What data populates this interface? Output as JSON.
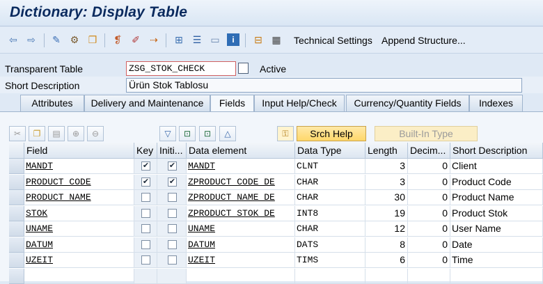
{
  "window": {
    "title": "Dictionary: Display Table"
  },
  "toolbar": {
    "icons": [
      "back-arrow-icon",
      "forward-arrow-icon",
      "other-object-icon",
      "display-change-icon",
      "activate-icon",
      "where-used-icon",
      "object-list-icon",
      "navigate-icon",
      "hierarchy-icon",
      "index-icon",
      "layout-icon",
      "info-icon",
      "tree-icon",
      "grid-icon"
    ],
    "technical_settings": "Technical Settings",
    "append_structure": "Append Structure..."
  },
  "header": {
    "table_type_label": "Transparent Table",
    "table_name": "ZSG_STOK_CHECK",
    "status": "Active",
    "short_desc_label": "Short Description",
    "short_desc_value": "Ürün Stok Tablosu"
  },
  "tabs": [
    {
      "label": "Attributes",
      "active": false
    },
    {
      "label": "Delivery and Maintenance",
      "active": false
    },
    {
      "label": "Fields",
      "active": true
    },
    {
      "label": "Input Help/Check",
      "active": false
    },
    {
      "label": "Currency/Quantity Fields",
      "active": false
    },
    {
      "label": "Indexes",
      "active": false
    }
  ],
  "grid_toolbar": {
    "search_help": "Srch Help",
    "built_in_type": "Built-In Type"
  },
  "table": {
    "columns": [
      "Field",
      "Key",
      "Initi...",
      "Data element",
      "Data Type",
      "Length",
      "Decim...",
      "Short Description"
    ],
    "rows": [
      {
        "field": "MANDT",
        "key": true,
        "init": true,
        "data_element": "MANDT",
        "data_type": "CLNT",
        "length": "3",
        "decimals": "0",
        "desc": "Client"
      },
      {
        "field": "PRODUCT_CODE",
        "key": true,
        "init": true,
        "data_element": "ZPRODUCT_CODE_DE",
        "data_type": "CHAR",
        "length": "3",
        "decimals": "0",
        "desc": "Product Code"
      },
      {
        "field": "PRODUCT_NAME",
        "key": false,
        "init": false,
        "data_element": "ZPRODUCT_NAME_DE",
        "data_type": "CHAR",
        "length": "30",
        "decimals": "0",
        "desc": "Product Name"
      },
      {
        "field": "STOK",
        "key": false,
        "init": false,
        "data_element": "ZPRODUCT_STOK_DE",
        "data_type": "INT8",
        "length": "19",
        "decimals": "0",
        "desc": "Product Stok"
      },
      {
        "field": "UNAME",
        "key": false,
        "init": false,
        "data_element": "UNAME",
        "data_type": "CHAR",
        "length": "12",
        "decimals": "0",
        "desc": "User Name"
      },
      {
        "field": "DATUM",
        "key": false,
        "init": false,
        "data_element": "DATUM",
        "data_type": "DATS",
        "length": "8",
        "decimals": "0",
        "desc": "Date"
      },
      {
        "field": "UZEIT",
        "key": false,
        "init": false,
        "data_element": "UZEIT",
        "data_type": "TIMS",
        "length": "6",
        "decimals": "0",
        "desc": "Time"
      }
    ]
  }
}
